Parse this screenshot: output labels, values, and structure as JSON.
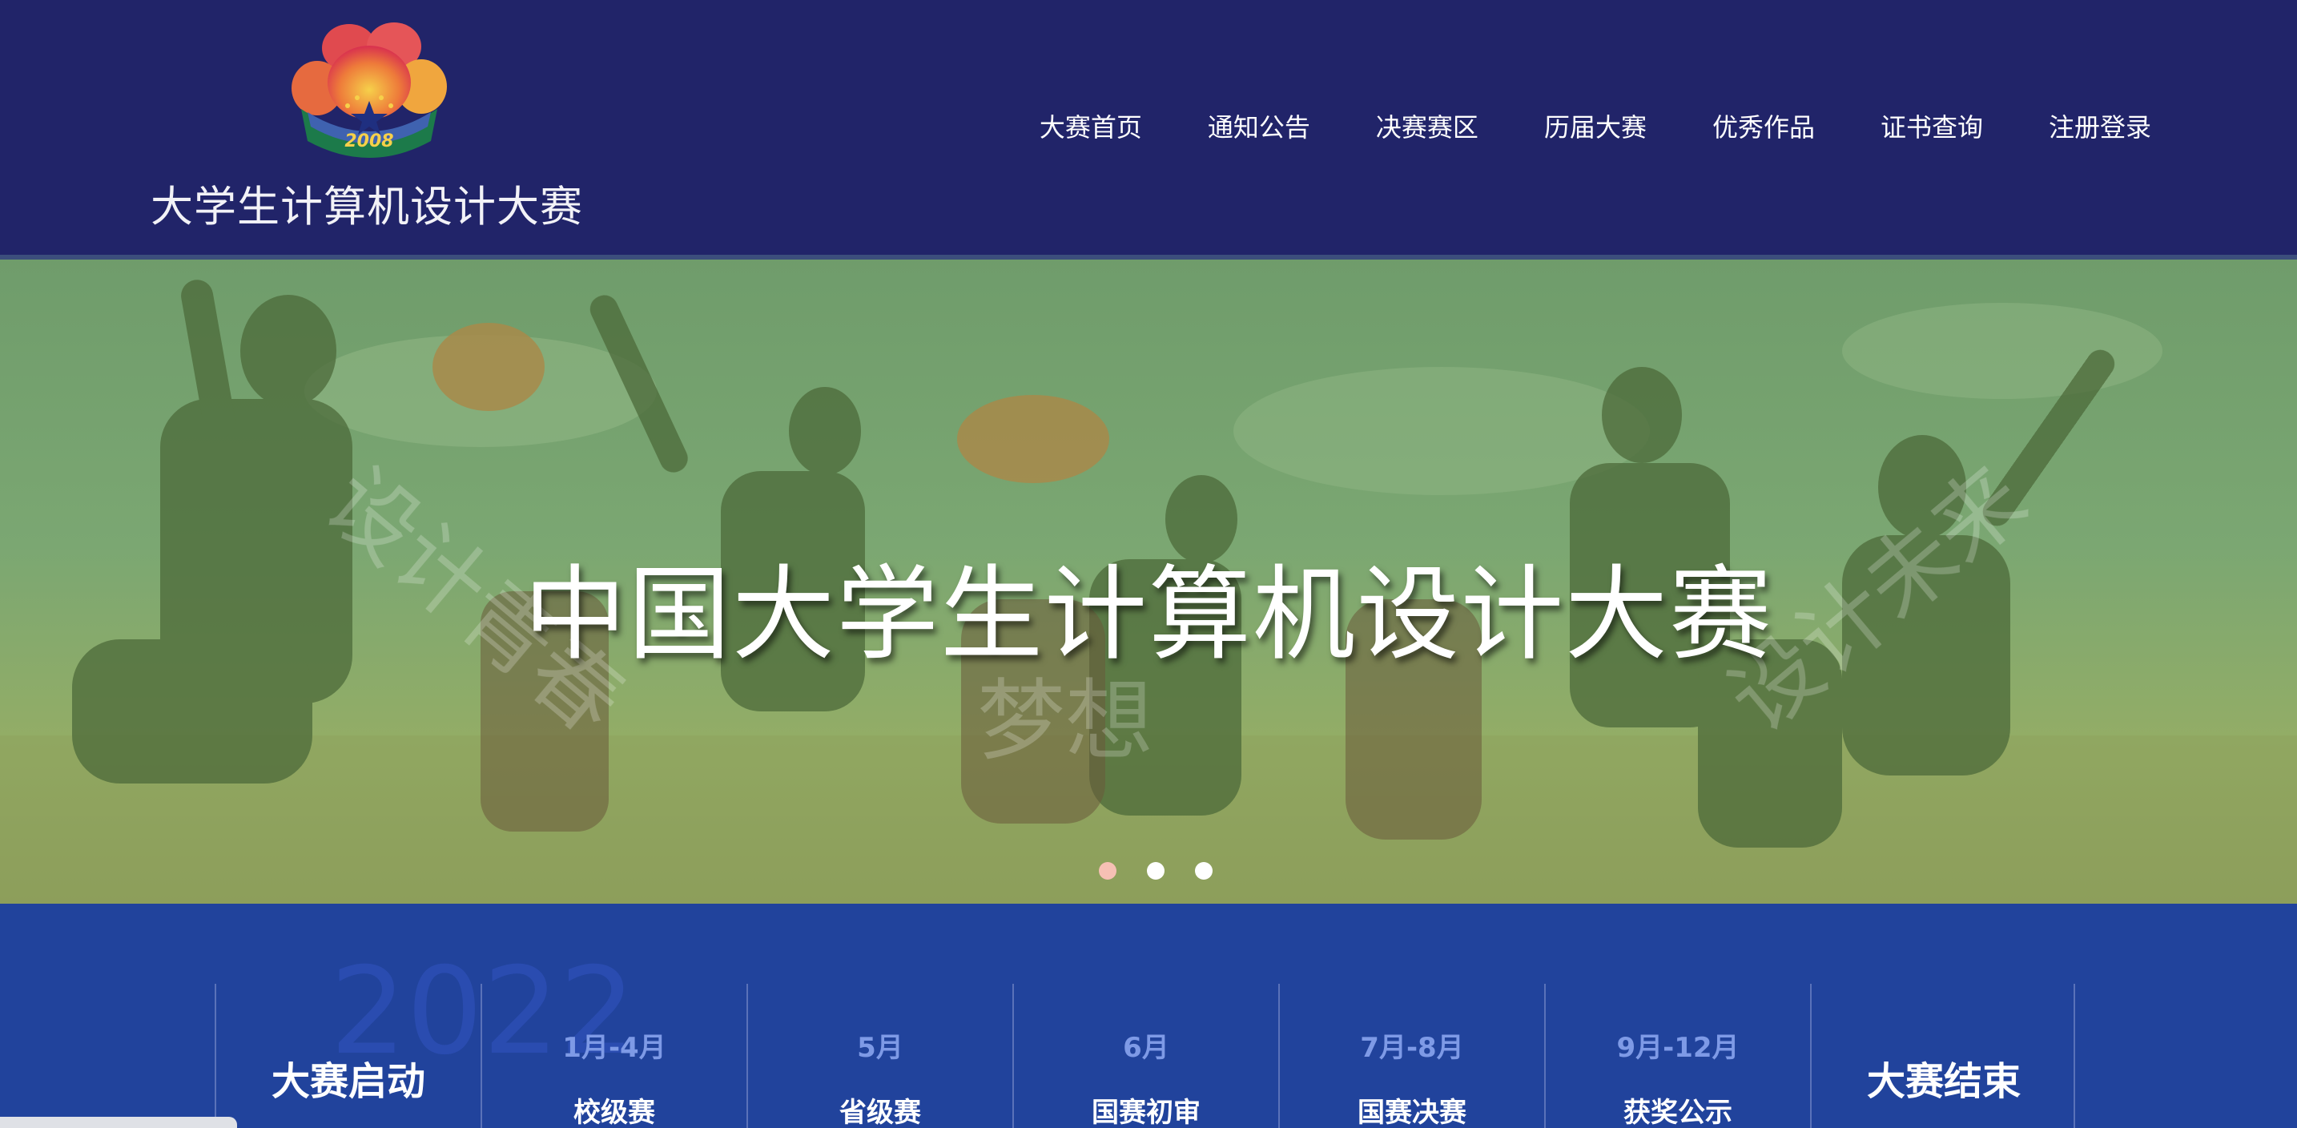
{
  "header": {
    "logo_year": "2008",
    "logo_title": "大学生计算机设计大赛"
  },
  "nav": [
    {
      "label": "大赛首页"
    },
    {
      "label": "通知公告"
    },
    {
      "label": "决赛赛区"
    },
    {
      "label": "历届大赛"
    },
    {
      "label": "优秀作品"
    },
    {
      "label": "证书查询"
    },
    {
      "label": "注册登录"
    }
  ],
  "banner": {
    "title": "中国大学生计算机设计大赛",
    "watermarks": [
      "设计青春",
      "梦想",
      "设计未来"
    ],
    "slide_count": 3,
    "active_slide": 1
  },
  "timeline": {
    "year": "2022",
    "steps": [
      {
        "period": "",
        "label": "大赛启动"
      },
      {
        "period": "1月-4月",
        "label": "校级赛"
      },
      {
        "period": "5月",
        "label": "省级赛"
      },
      {
        "period": "6月",
        "label": "国赛初审"
      },
      {
        "period": "7月-8月",
        "label": "国赛决赛"
      },
      {
        "period": "9月-12月",
        "label": "获奖公示"
      },
      {
        "period": "",
        "label": "大赛结束"
      }
    ]
  },
  "colors": {
    "header_bg": "#212469",
    "timeline_bg": "#21439c",
    "period_text": "#7e9ae6",
    "active_dot": "#f6c0b4"
  }
}
